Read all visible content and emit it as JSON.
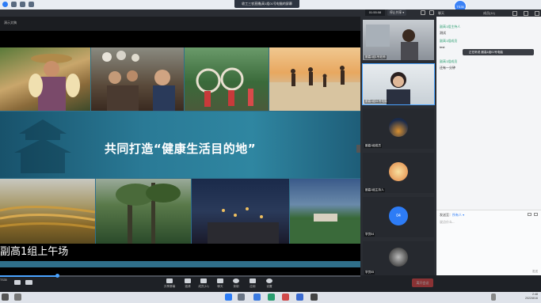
{
  "window": {
    "title": "收工三农直播|高1组01号电脑的屏幕"
  },
  "header": {
    "meeting_time": "01:55:08",
    "record_label": "停止共享 ▾",
    "chat_user": "聊天",
    "avatar_initials": "TS35",
    "participants": "成员(11)"
  },
  "stage": {
    "share_label": "演示文稿",
    "banner_text": "共同打造“健康生活目的地”",
    "caption": "副高1组上午场"
  },
  "videos": [
    {
      "name": "副高1组1号老师"
    },
    {
      "name": "副高1组01号电脑"
    },
    {
      "name": "副高1组成员"
    },
    {
      "name": "副高1组主持人"
    },
    {
      "name": "04",
      "label": "学员04"
    },
    {
      "name": "学员05"
    }
  ],
  "chat": {
    "messages": [
      {
        "sender": "副高1组主持人",
        "body": "测试"
      },
      {
        "sender": "副高1组成员",
        "body": "test"
      },
      {
        "sender": "副高1组成员",
        "body": "还有一分钟"
      }
    ],
    "toast": "正在听说 副高1组01号电脑",
    "send_to_label": "发送至：",
    "send_to_value": "所有人 ▾",
    "input_placeholder": "说点什么...",
    "send_label": "发送"
  },
  "controls": {
    "camera_label": "TS35",
    "items": [
      {
        "label": "共享屏幕"
      },
      {
        "label": "邀请"
      },
      {
        "label": "成员(11)"
      },
      {
        "label": "聊天"
      },
      {
        "label": "录制"
      },
      {
        "label": "应用"
      },
      {
        "label": "设置"
      }
    ],
    "leave_label": "离开会议"
  },
  "taskbar": {
    "time": "2:48",
    "date": "2022/8/16"
  }
}
